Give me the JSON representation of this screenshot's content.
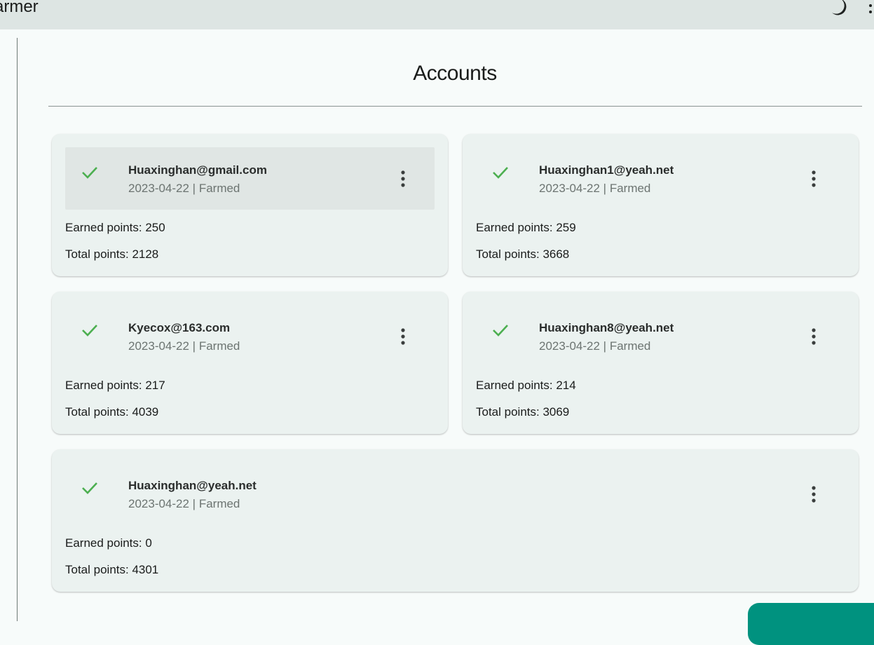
{
  "app": {
    "title": "armer"
  },
  "page": {
    "title": "Accounts"
  },
  "accounts": [
    {
      "email": "Huaxinghan@gmail.com",
      "date": "2023-04-22",
      "status": "Farmed",
      "sub": "2023-04-22 | Farmed",
      "earned": "Earned points: 250",
      "total": "Total points: 2128"
    },
    {
      "email": "Huaxinghan1@yeah.net",
      "date": "2023-04-22",
      "status": "Farmed",
      "sub": "2023-04-22 | Farmed",
      "earned": "Earned points: 259",
      "total": "Total points: 3668"
    },
    {
      "email": "Kyecox@163.com",
      "date": "2023-04-22",
      "status": "Farmed",
      "sub": "2023-04-22 | Farmed",
      "earned": "Earned points: 217",
      "total": "Total points: 4039"
    },
    {
      "email": "Huaxinghan8@yeah.net",
      "date": "2023-04-22",
      "status": "Farmed",
      "sub": "2023-04-22 | Farmed",
      "earned": "Earned points: 214",
      "total": "Total points: 3069"
    },
    {
      "email": "Huaxinghan@yeah.net",
      "date": "2023-04-22",
      "status": "Farmed",
      "sub": "2023-04-22 | Farmed",
      "earned": "Earned points: 0",
      "total": "Total points: 4301"
    }
  ],
  "icons": {
    "theme": "moon-icon",
    "status": "check-icon",
    "menu": "more-vert-icon"
  },
  "colors": {
    "accent": "#00927f",
    "check": "#4caf50",
    "topbar": "#dde5e3",
    "card": "#ebf2f0"
  }
}
